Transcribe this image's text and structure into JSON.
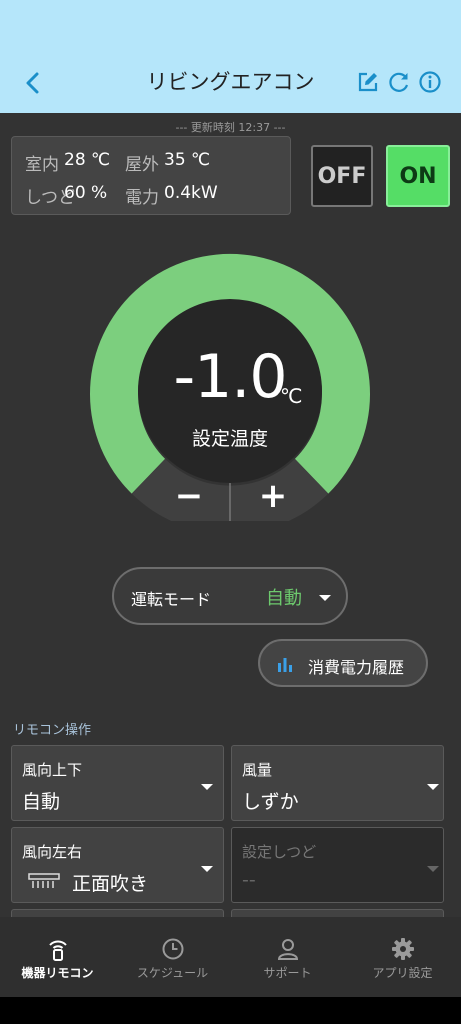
{
  "header": {
    "title": "リビングエアコン"
  },
  "updated": "--- 更新時刻 12:37 ---",
  "status": {
    "indoor_label": "室内",
    "indoor_value": "28 ℃",
    "outdoor_label": "屋外",
    "outdoor_value": "35 ℃",
    "humidity_label": "しつど",
    "humidity_value": "60 %",
    "power_label": "電力",
    "power_value": "0.4kW"
  },
  "power_buttons": {
    "off": "OFF",
    "on": "ON"
  },
  "dial": {
    "temp": "-1.0",
    "unit": "℃",
    "label": "設定温度",
    "minus": "−",
    "plus": "+"
  },
  "mode": {
    "label": "運転モード",
    "value": "自動"
  },
  "history": {
    "label": "消費電力履歴"
  },
  "section_label": "リモコン操作",
  "controls": [
    {
      "label": "風向上下",
      "value": "自動"
    },
    {
      "label": "風量",
      "value": "しずか"
    },
    {
      "label": "風向左右",
      "value": "正面吹き"
    },
    {
      "label": "設定しつど",
      "value": "--"
    }
  ],
  "nav": [
    {
      "label": "機器リモコン",
      "icon": "remote-icon"
    },
    {
      "label": "スケジュール",
      "icon": "clock-icon"
    },
    {
      "label": "サポート",
      "icon": "person-icon"
    },
    {
      "label": "アプリ設定",
      "icon": "gear-icon"
    }
  ],
  "colors": {
    "header_bg": "#b5e6fa",
    "accent_green": "#7ccf7e",
    "on_green": "#55dd66",
    "icon_blue": "#1a8fc9"
  }
}
